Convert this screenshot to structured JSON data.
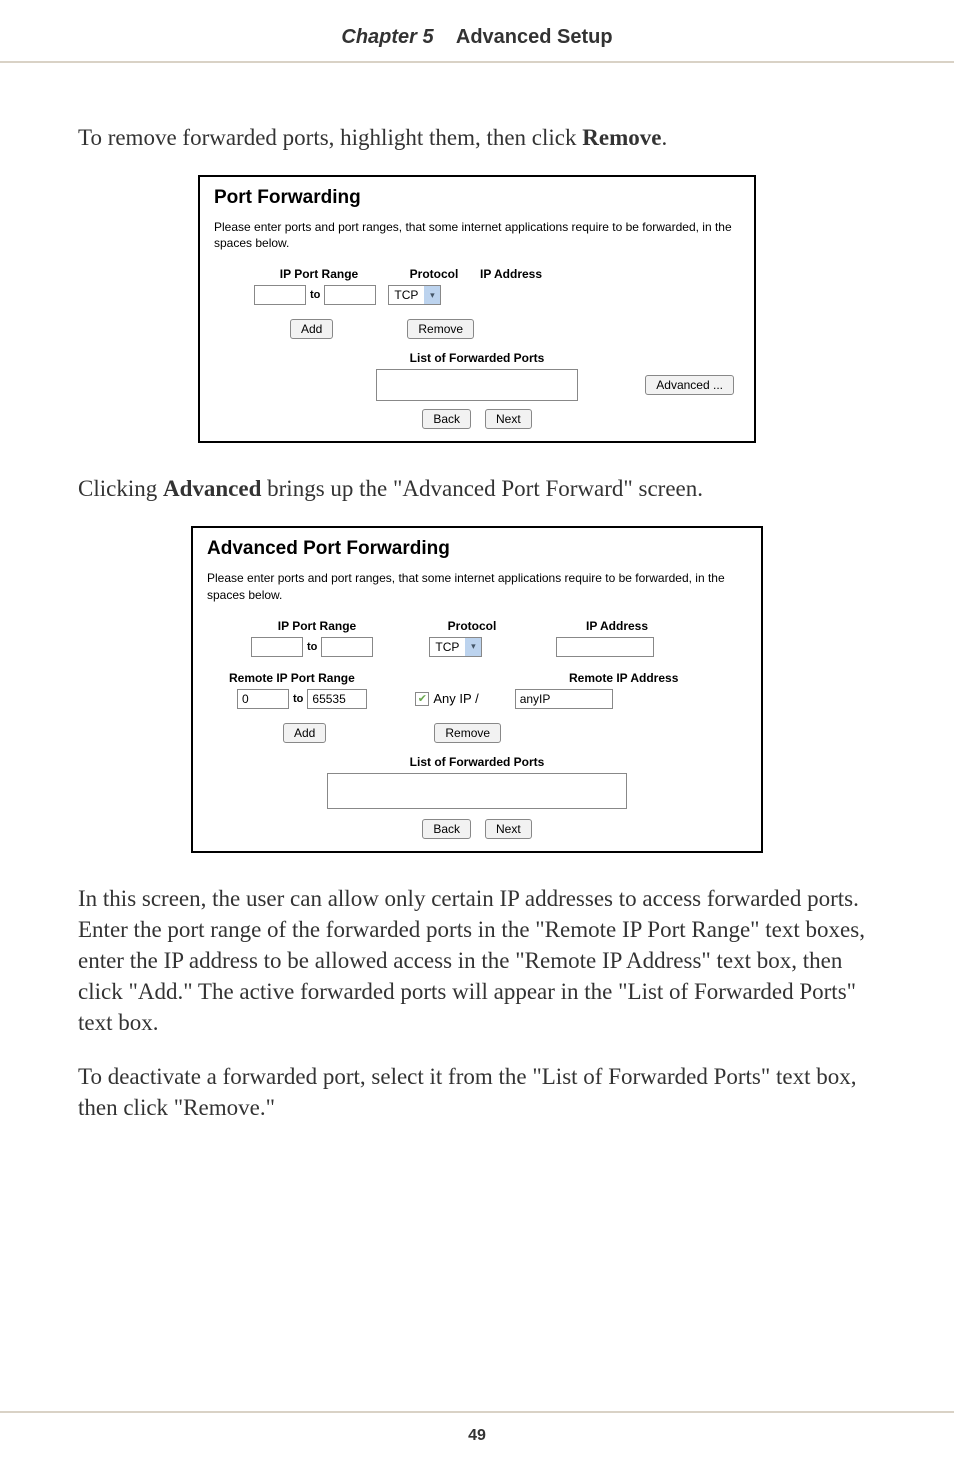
{
  "header": {
    "chapter": "Chapter 5",
    "section": "Advanced Setup"
  },
  "para1_a": "To remove forwarded ports, highlight them, then click ",
  "para1_b": "Remove",
  "para1_c": ".",
  "dialog1": {
    "title": "Port Forwarding",
    "desc": "Please enter ports and port ranges, that some internet applications require to be forwarded, in the spaces below.",
    "labels": {
      "ip_port_range": "IP Port Range",
      "protocol": "Protocol",
      "ip_address": "IP Address",
      "to": "to"
    },
    "protocol_value": "TCP",
    "buttons": {
      "add": "Add",
      "remove": "Remove",
      "advanced": "Advanced ...",
      "back": "Back",
      "next": "Next"
    },
    "list_heading": "List of Forwarded Ports"
  },
  "para2_a": "Clicking ",
  "para2_b": "Advanced",
  "para2_c": " brings up the \"Advanced Port Forward\" screen.",
  "dialog2": {
    "title": "Advanced Port Forwarding",
    "desc": "Please enter ports and port ranges, that some internet applications require to be forwarded, in the spaces below.",
    "labels": {
      "ip_port_range": "IP Port Range",
      "protocol": "Protocol",
      "ip_address": "IP Address",
      "remote_ip_port_range": "Remote IP Port Range",
      "remote_ip_address": "Remote IP Address",
      "to": "to",
      "any_ip": "Any IP /"
    },
    "protocol_value": "TCP",
    "remote_from": "0",
    "remote_to": "65535",
    "remote_ip_value": "anyIP",
    "buttons": {
      "add": "Add",
      "remove": "Remove",
      "back": "Back",
      "next": "Next"
    },
    "list_heading": "List of Forwarded Ports"
  },
  "para3": "In this screen, the user can allow only certain IP addresses to access forwarded ports. Enter the port range of the forwarded ports in the \"Remote IP Port Range\" text boxes, enter the IP address to be allowed access in the \"Remote IP Address\" text box, then click \"Add.\" The active forwarded ports will appear in the \"List of Forwarded Ports\" text box.",
  "para4": "To deactivate a forwarded port, select it from the \"List of Forwarded Ports\" text box, then click \"Remove.\"",
  "page_number": "49"
}
